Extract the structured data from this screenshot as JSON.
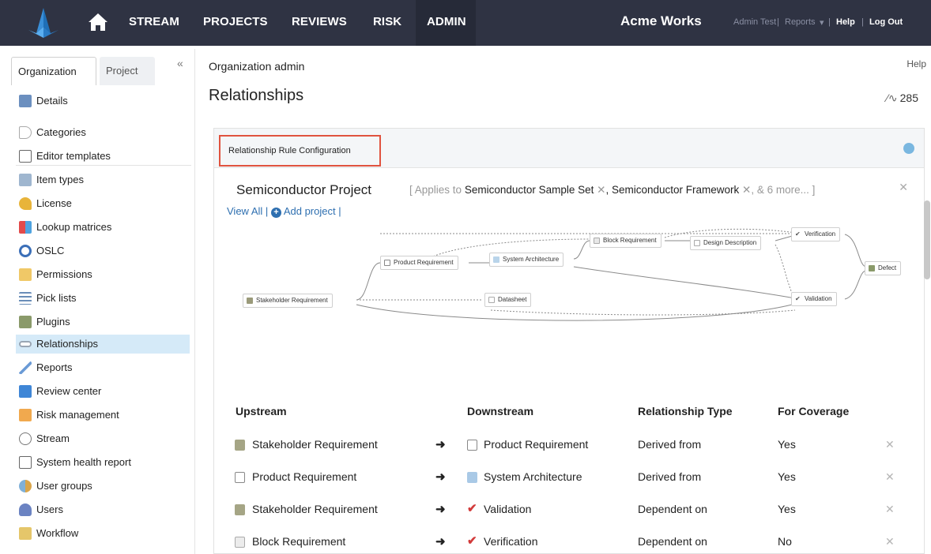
{
  "nav": {
    "items": [
      "STREAM",
      "PROJECTS",
      "REVIEWS",
      "RISK",
      "ADMIN"
    ],
    "active": "ADMIN",
    "brand": "Acme Works",
    "user": "Admin Test",
    "reports": "Reports",
    "help": "Help",
    "logout": "Log Out"
  },
  "sidebar": {
    "tabs": [
      "Organization",
      "Project"
    ],
    "active_tab": "Organization",
    "top_item": "Details",
    "items": [
      "Categories",
      "Editor templates",
      "Item types",
      "License",
      "Lookup matrices",
      "OSLC",
      "Permissions",
      "Pick lists",
      "Plugins",
      "Relationships",
      "Reports",
      "Review center",
      "Risk management",
      "Stream",
      "System health report",
      "User groups",
      "Users",
      "Workflow"
    ],
    "selected": "Relationships"
  },
  "main": {
    "breadcrumb": "Organization admin",
    "help": "Help",
    "title": "Relationships",
    "pulse_count": "285",
    "panel_title": "Relationship Rule Configuration",
    "project_name": "Semiconductor Project",
    "applies_prefix": "[ Applies to",
    "applies_set": "Semiconductor Sample Set",
    "applies_framework": "Semiconductor Framework",
    "applies_more": ", & 6 more... ]",
    "view_all": "View All",
    "add_project": "Add project"
  },
  "diagram": {
    "nodes": [
      "Stakeholder Requirement",
      "Product Requirement",
      "System Architecture",
      "Datasheet",
      "Block Requirement",
      "Design Description",
      "Verification",
      "Validation",
      "Defect"
    ]
  },
  "table": {
    "headers": [
      "Upstream",
      "Downstream",
      "Relationship Type",
      "For Coverage"
    ],
    "rows": [
      {
        "upstream": "Stakeholder Requirement",
        "downstream": "Product Requirement",
        "type": "Derived from",
        "coverage": "Yes"
      },
      {
        "upstream": "Product Requirement",
        "downstream": "System Architecture",
        "type": "Derived from",
        "coverage": "Yes"
      },
      {
        "upstream": "Stakeholder Requirement",
        "downstream": "Validation",
        "type": "Dependent on",
        "coverage": "Yes"
      },
      {
        "upstream": "Block Requirement",
        "downstream": "Verification",
        "type": "Dependent on",
        "coverage": "No"
      }
    ]
  },
  "colors": {
    "nav_bg": "#2f3343",
    "selected_bg": "#d5eaf8",
    "highlight_border": "#e0533f",
    "link": "#2e6fb0"
  }
}
